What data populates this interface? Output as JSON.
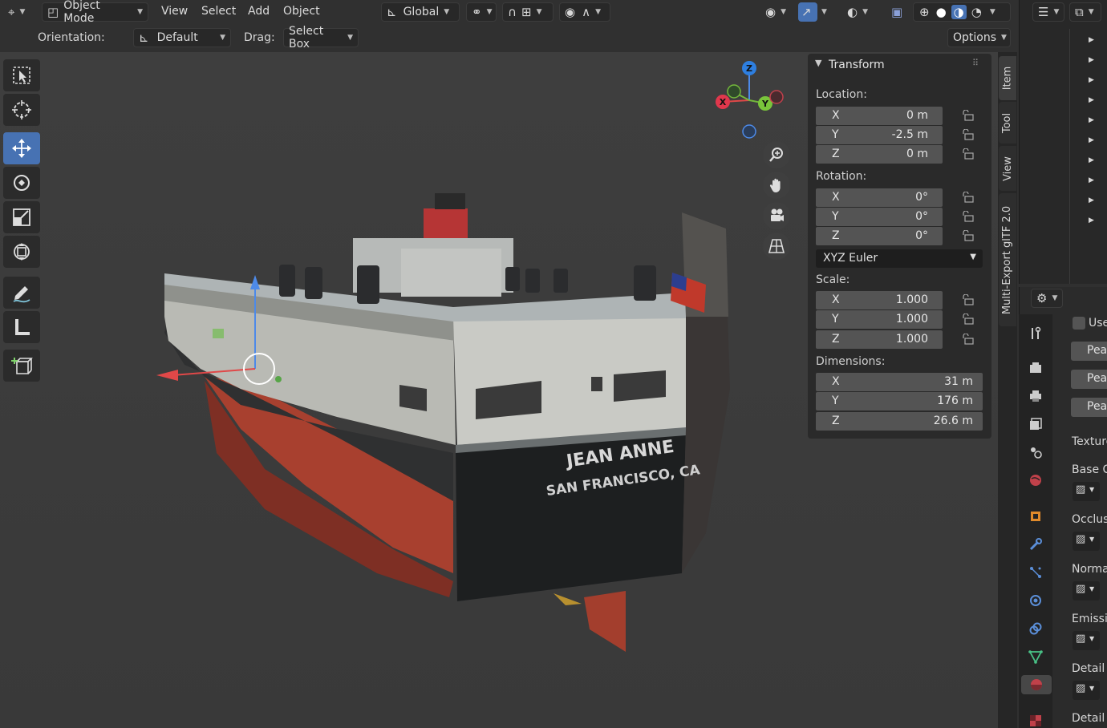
{
  "header": {
    "mode_label": "Object Mode",
    "menus": [
      "View",
      "Select",
      "Add",
      "Object"
    ],
    "transform_orientation": "Global",
    "orientation_label": "Orientation:",
    "orientation_value": "Default",
    "drag_label": "Drag:",
    "drag_value": "Select Box",
    "options_label": "Options"
  },
  "gizmo": {
    "x": "X",
    "y": "Y",
    "z": "Z"
  },
  "ship": {
    "name_line1": "JEAN ANNE",
    "name_line2": "SAN FRANCISCO, CA"
  },
  "npanel": {
    "title": "Transform",
    "location_label": "Location:",
    "location": [
      {
        "axis": "X",
        "value": "0 m"
      },
      {
        "axis": "Y",
        "value": "-2.5 m"
      },
      {
        "axis": "Z",
        "value": "0 m"
      }
    ],
    "rotation_label": "Rotation:",
    "rotation": [
      {
        "axis": "X",
        "value": "0°"
      },
      {
        "axis": "Y",
        "value": "0°"
      },
      {
        "axis": "Z",
        "value": "0°"
      }
    ],
    "rotation_mode": "XYZ Euler",
    "scale_label": "Scale:",
    "scale": [
      {
        "axis": "X",
        "value": "1.000"
      },
      {
        "axis": "Y",
        "value": "1.000"
      },
      {
        "axis": "Z",
        "value": "1.000"
      }
    ],
    "dimensions_label": "Dimensions:",
    "dimensions": [
      {
        "axis": "X",
        "value": "31 m"
      },
      {
        "axis": "Y",
        "value": "176 m"
      },
      {
        "axis": "Z",
        "value": "26.6 m"
      }
    ]
  },
  "sidebar_tabs": [
    "Item",
    "Tool",
    "View",
    "Multi-Export glTF 2.0"
  ],
  "properties": {
    "use_label": "Use",
    "buttons": [
      "Pear",
      "Pear",
      "Pear"
    ],
    "labels": [
      "Texture",
      "Base C",
      "Occlusi",
      "Norma",
      "Emissiv",
      "Detail C",
      "Detail N"
    ]
  }
}
